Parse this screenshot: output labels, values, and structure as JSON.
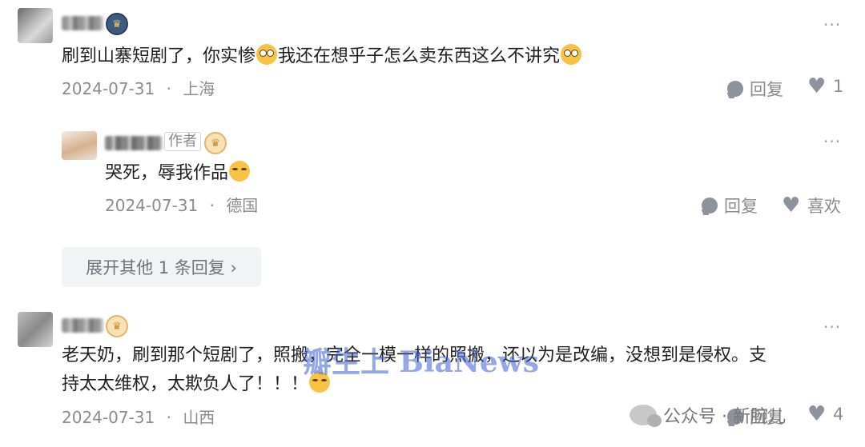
{
  "comments": [
    {
      "content_a": "刷到山寨短剧了，你实惨",
      "content_b": "我还在想乎子怎么卖东西这么不讲究",
      "date": "2024-07-31",
      "sep": "·",
      "location": "上海",
      "reply_label": "回复",
      "like_count": "1",
      "more": "···"
    },
    {
      "author_tag": "作者",
      "content": "哭死，辱我作品",
      "date": "2024-07-31",
      "sep": "·",
      "location": "德国",
      "reply_label": "回复",
      "like_label": "喜欢",
      "more": "···"
    },
    {
      "line1": "老天奶，刷到那个短剧了，照搬，完全一模一样的照搬，还以为是改编，没想到是侵权。支",
      "line2": "持太太维权，太欺负人了！！！",
      "date": "2024-07-31",
      "sep": "·",
      "location": "山西",
      "reply_label": "回复",
      "like_count": "4",
      "more": "···"
    }
  ],
  "expand_label": "展开其他 1 条回复 ›",
  "watermark": "瓣生上 BiaNews",
  "wechat_label": "公众号 · 新腕儿"
}
